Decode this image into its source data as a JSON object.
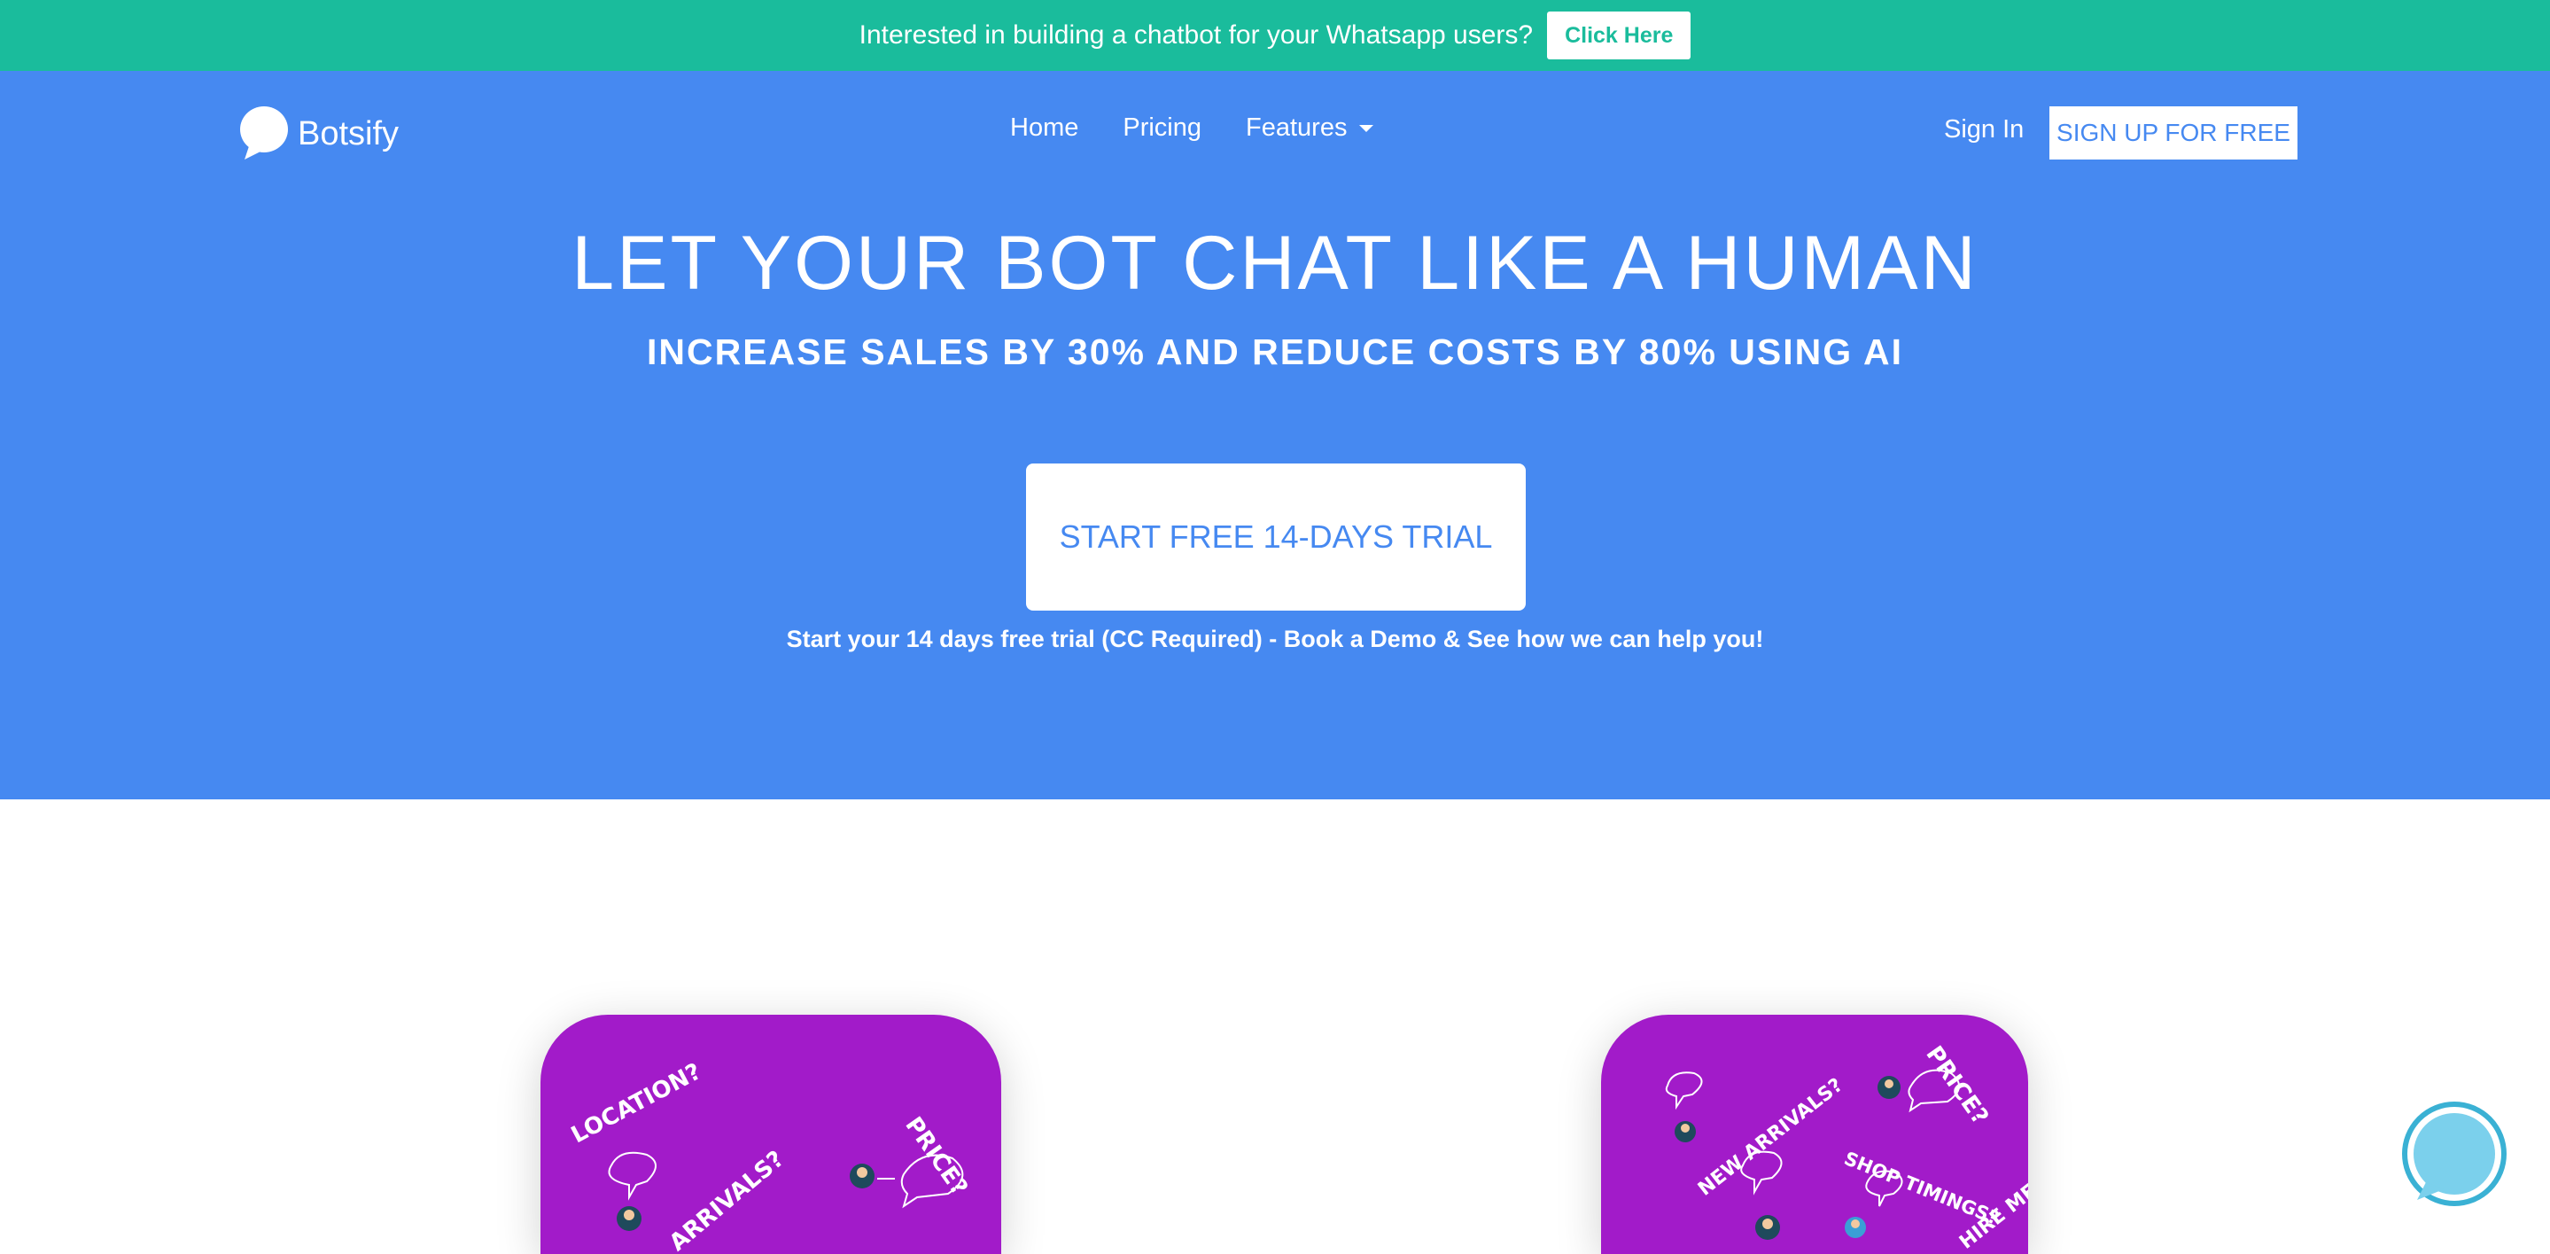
{
  "promo": {
    "text": "Interested in building a chatbot for your Whatsapp users?",
    "button_label": "Click Here"
  },
  "nav": {
    "logo_text": "Botsify",
    "links": [
      {
        "label": "Home"
      },
      {
        "label": "Pricing"
      },
      {
        "label": "Features"
      }
    ],
    "signin_label": "Sign In",
    "signup_label": "SIGN UP FOR FREE"
  },
  "hero": {
    "title": "LET YOUR BOT CHAT LIKE A HUMAN",
    "subtitle": "INCREASE SALES BY 30% AND REDUCE COSTS BY 80% USING AI",
    "cta_label": "START FREE 14-DAYS TRIAL",
    "cta_note": "Start your 14 days free trial (CC Required) - Book a Demo & See how we can help you!"
  },
  "illustrations": {
    "left": [
      "LOCATION?",
      "PRICE?",
      "ARRIVALS?"
    ],
    "right": [
      "PRICE?",
      "NEW ARRIVALS?",
      "SHOP TIMINGS?",
      "HIRE ME"
    ]
  },
  "colors": {
    "promo_bg": "#1abc9c",
    "hero_bg": "#4689f1",
    "card_bg": "#a21bc9"
  },
  "icons": {
    "logo": "speech-bubble-icon",
    "chat_widget": "chat-bubble-icon"
  }
}
